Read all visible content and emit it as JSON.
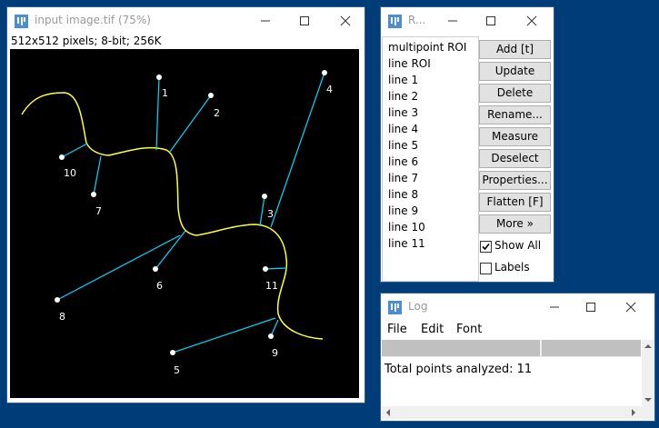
{
  "colors": {
    "desktop": "#003c78",
    "roi_line": "#00d8ff",
    "skeleton": "#ffff33",
    "point": "#ffffff"
  },
  "image_window": {
    "title": "input image.tif (75%)",
    "info": "512x512 pixels; 8-bit; 256K",
    "point_labels": [
      "1",
      "2",
      "3",
      "4",
      "5",
      "6",
      "7",
      "8",
      "9",
      "10",
      "11"
    ]
  },
  "roi_window": {
    "title": "R...",
    "list": [
      "multipoint ROI",
      "line ROI",
      "line 1",
      "line 2",
      "line 3",
      "line 4",
      "line 5",
      "line 6",
      "line 7",
      "line 8",
      "line 9",
      "line 10",
      "line 11"
    ],
    "buttons": [
      "Add [t]",
      "Update",
      "Delete",
      "Rename...",
      "Measure",
      "Deselect",
      "Properties...",
      "Flatten [F]",
      "More »"
    ],
    "show_all": {
      "label": "Show All",
      "checked": true
    },
    "labels": {
      "label": "Labels",
      "checked": false
    }
  },
  "log_window": {
    "title": "Log",
    "menu": [
      "File",
      "Edit",
      "Font"
    ],
    "text": "Total points analyzed: 11"
  },
  "icons": [
    "imagej-icon",
    "minimize-icon",
    "maximize-icon",
    "close-icon",
    "scroll-up-arrow-icon",
    "scroll-down-arrow-icon",
    "scroll-left-arrow-icon",
    "scroll-right-arrow-icon"
  ]
}
